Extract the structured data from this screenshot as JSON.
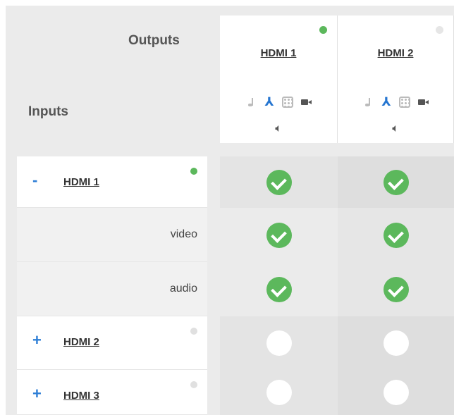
{
  "matrix": {
    "outputs_label": "Outputs",
    "inputs_label": "Inputs"
  },
  "outputs": [
    {
      "name": "HDMI 1",
      "status_color": "#5cb85c",
      "icons": [
        "music-note-icon",
        "usb-icon",
        "grid-icon",
        "camera-icon"
      ],
      "volume_icon": "speaker-icon",
      "volume_glyph": "🔈︎"
    },
    {
      "name": "HDMI 2",
      "status_color": "#e6e6e6",
      "icons": [
        "music-note-icon",
        "usb-icon",
        "grid-icon",
        "camera-icon"
      ],
      "volume_icon": "speaker-icon",
      "volume_glyph": "🔈︎"
    }
  ],
  "inputs": [
    {
      "name": "HDMI 1",
      "expand_glyph": "-",
      "status_color": "#5cb85c",
      "routes": [
        true,
        true
      ]
    },
    {
      "sub_label": "video",
      "routes": [
        true,
        true
      ]
    },
    {
      "sub_label": "audio",
      "routes": [
        true,
        true
      ]
    },
    {
      "name": "HDMI 2",
      "expand_glyph": "+",
      "status_color": "#e0e0e0",
      "routes": [
        false,
        false
      ]
    },
    {
      "name": "HDMI 3",
      "expand_glyph": "+",
      "status_color": "#e0e0e0",
      "routes": [
        false,
        false
      ]
    }
  ],
  "colors": {
    "accent": "#2f7fd6",
    "routed": "#5cb85c"
  }
}
